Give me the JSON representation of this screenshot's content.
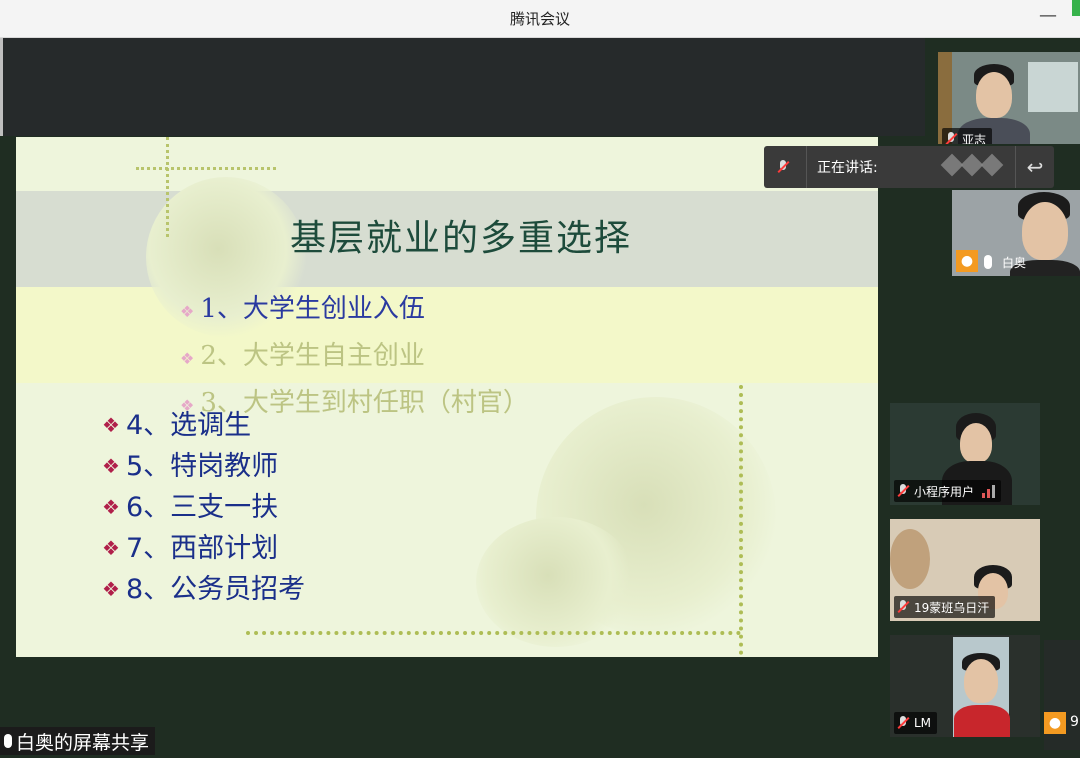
{
  "window": {
    "title": "腾讯会议",
    "minimize_glyph": "—"
  },
  "slide": {
    "title": "基层就业的多重选择",
    "faint_items": [
      "1、大学生创业入伍",
      "2、大学生自主创业",
      "3、大学生到村任职（村官）"
    ],
    "items": [
      "4、选调生",
      "5、特岗教师",
      "6、三支一扶",
      "7、西部计划",
      "8、公务员招考"
    ],
    "bullet_glyph": "❖"
  },
  "share": {
    "label": "白奥的屏幕共享"
  },
  "speaking_panel": {
    "label": "正在讲话:",
    "back_glyph": "↩"
  },
  "participants": {
    "top": {
      "name": "亚志"
    },
    "p2": {
      "name": "白奥"
    },
    "p3": {
      "name": "小程序用户"
    },
    "p4": {
      "name": "19蒙班乌日汗"
    },
    "p5": {
      "name": "LM"
    },
    "p6": {
      "label": "9"
    }
  },
  "colors": {
    "accent_orange": "#f39a21",
    "muted_red": "#ff3b3b",
    "slide_title": "#1d4b3b",
    "slide_text": "#1a2f8a"
  },
  "icons": [
    "microphone-icon",
    "muted-microphone-icon",
    "avatar-icon",
    "signal-bars-icon",
    "return-icon",
    "bullet-icon"
  ]
}
